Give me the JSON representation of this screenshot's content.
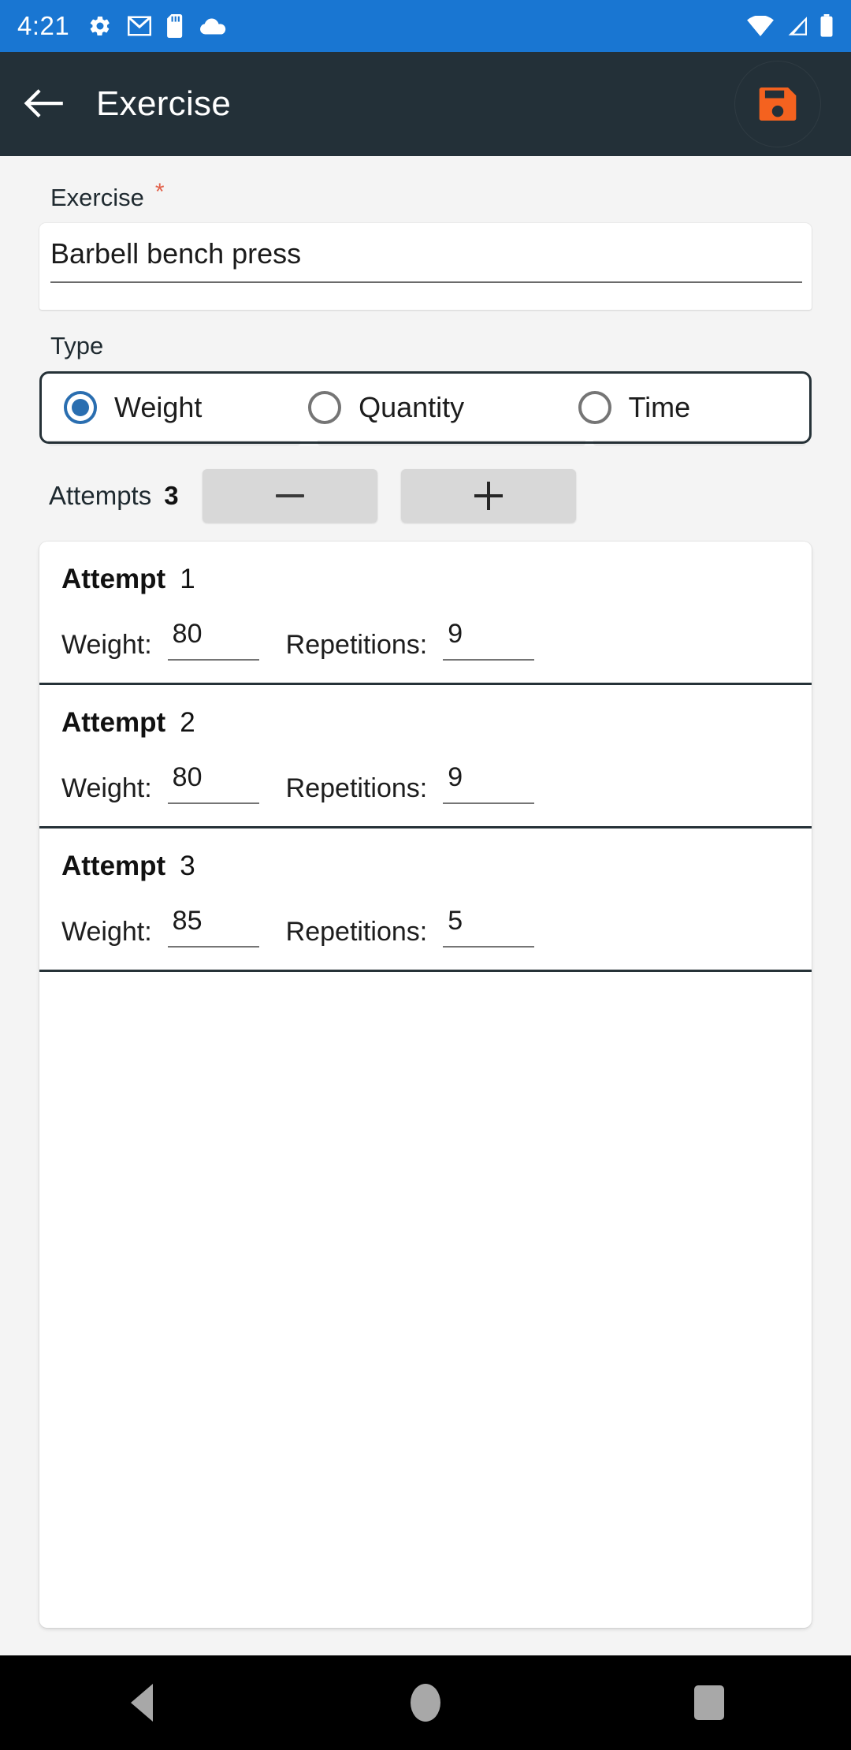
{
  "status_bar": {
    "time": "4:21",
    "background": "#1976d2",
    "left_icons": [
      "gear-icon",
      "gmail-icon",
      "sd-card-icon",
      "cloud-icon"
    ],
    "right_icons": [
      "wifi-icon",
      "cell-signal-icon",
      "battery-icon"
    ]
  },
  "app_bar": {
    "title": "Exercise",
    "background": "#233038",
    "back_icon": "arrow-back-icon",
    "save_icon": "save-floppy-icon",
    "save_icon_color": "#f4621f"
  },
  "form": {
    "exercise": {
      "label": "Exercise",
      "required_marker": "*",
      "required_color": "#e2614a",
      "value": "Barbell bench press",
      "placeholder": "Exercise"
    },
    "type": {
      "label": "Type",
      "selected": "Weight",
      "accent": "#2a6eb0",
      "options": [
        {
          "label": "Weight",
          "checked": true
        },
        {
          "label": "Quantity",
          "checked": false
        },
        {
          "label": "Time",
          "checked": false
        }
      ]
    },
    "attempts": {
      "label": "Attempts",
      "count": "3",
      "decrement_label": "−",
      "increment_label": "+"
    }
  },
  "attempts_list": {
    "title_word": "Attempt",
    "weight_label": "Weight:",
    "repetitions_label": "Repetitions:",
    "rows": [
      {
        "index": "1",
        "weight": "80",
        "repetitions": "9"
      },
      {
        "index": "2",
        "weight": "80",
        "repetitions": "9"
      },
      {
        "index": "3",
        "weight": "85",
        "repetitions": "5"
      }
    ]
  },
  "nav_bar": {
    "back": "nav-back-icon",
    "home": "nav-home-icon",
    "recents": "nav-recents-icon"
  }
}
